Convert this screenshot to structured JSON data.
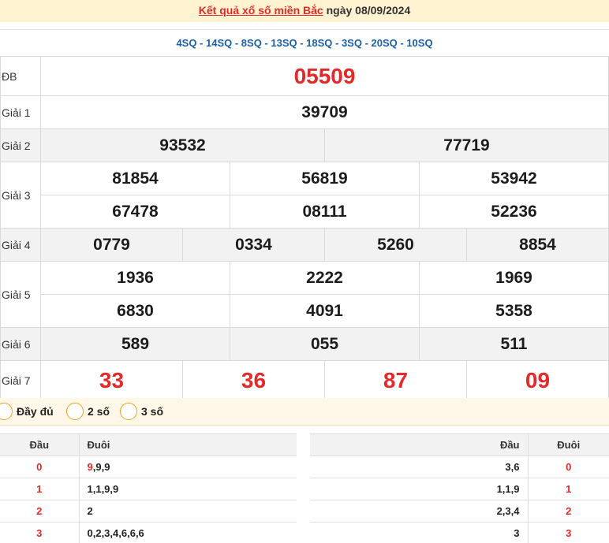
{
  "header": {
    "title_link": "Kết quả xổ số miền Bắc",
    "title_date": "ngày 08/09/2024"
  },
  "codes": "4SQ - 14SQ - 8SQ - 13SQ - 18SQ - 3SQ - 20SQ - 10SQ",
  "prizes": {
    "db": {
      "label": "ĐB",
      "value": "05509"
    },
    "g1": {
      "label": "Giải 1",
      "values": [
        "39709"
      ]
    },
    "g2": {
      "label": "Giải 2",
      "values": [
        "93532",
        "77719"
      ]
    },
    "g3": {
      "label": "Giải 3",
      "values": [
        "81854",
        "56819",
        "53942",
        "67478",
        "08111",
        "52236"
      ]
    },
    "g4": {
      "label": "Giải 4",
      "values": [
        "0779",
        "0334",
        "5260",
        "8854"
      ]
    },
    "g5": {
      "label": "Giải 5",
      "values": [
        "1936",
        "2222",
        "1969",
        "6830",
        "4091",
        "5358"
      ]
    },
    "g6": {
      "label": "Giải 6",
      "values": [
        "589",
        "055",
        "511"
      ]
    },
    "g7": {
      "label": "Giải 7",
      "values": [
        "33",
        "36",
        "87",
        "09"
      ]
    }
  },
  "filters": [
    "Đầy đủ",
    "2 số",
    "3 số"
  ],
  "dau_table": {
    "head_dau": "Đầu",
    "head_duoi": "Đuôi",
    "rows": [
      {
        "dau": "0",
        "first": "9",
        "rest": ",9,9"
      },
      {
        "dau": "1",
        "first": "",
        "rest": "1,1,9,9"
      },
      {
        "dau": "2",
        "first": "",
        "rest": "2"
      },
      {
        "dau": "3",
        "first": "",
        "rest": "0,2,3,4,6,6,6"
      }
    ]
  },
  "duoi_table": {
    "head_dau": "Đầu",
    "head_duoi": "Đuôi",
    "rows": [
      {
        "dau": "3,6",
        "duoi": "0"
      },
      {
        "dau": "1,1,9",
        "duoi": "1"
      },
      {
        "dau": "2,3,4",
        "duoi": "2"
      },
      {
        "dau": "3",
        "duoi": "3"
      }
    ]
  }
}
